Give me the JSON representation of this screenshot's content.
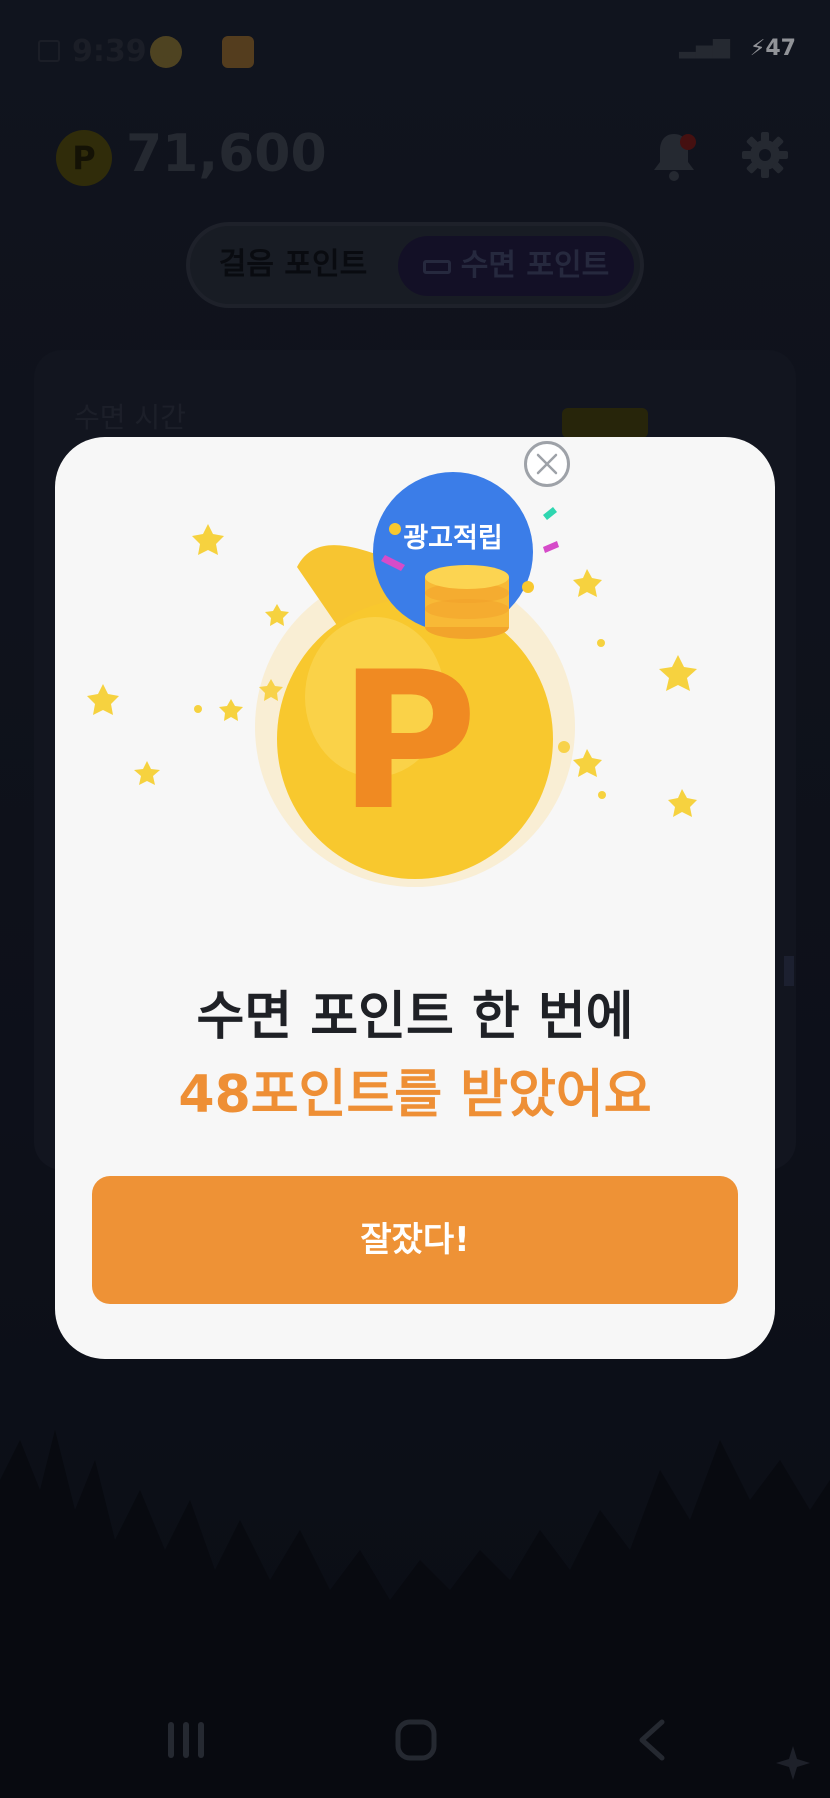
{
  "status_bar": {
    "time": "9:39",
    "battery": "47"
  },
  "header": {
    "points": "71,600",
    "coin_symbol": "P"
  },
  "tabs": [
    {
      "label": "걸음 포인트"
    },
    {
      "label": "수면 포인트"
    }
  ],
  "card": {
    "sleep_time_label": "수면 시간"
  },
  "modal": {
    "ad_badge": "광고적립",
    "bag_letter": "P",
    "title_line1": "수면 포인트 한 번에",
    "title_line2": "48포인트를 받았어요",
    "confirm_label": "잘잤다!"
  },
  "colors": {
    "accent_orange": "#ee9236",
    "highlight_text": "#ee8f35",
    "badge_blue": "#3b7de8",
    "modal_bg": "#f7f7f7"
  },
  "icons": [
    "bell-icon",
    "gear-icon",
    "bed-icon",
    "close-icon",
    "money-bag-icon",
    "coin-stack-icon",
    "nav-recent-icon",
    "nav-home-icon",
    "nav-back-icon"
  ]
}
